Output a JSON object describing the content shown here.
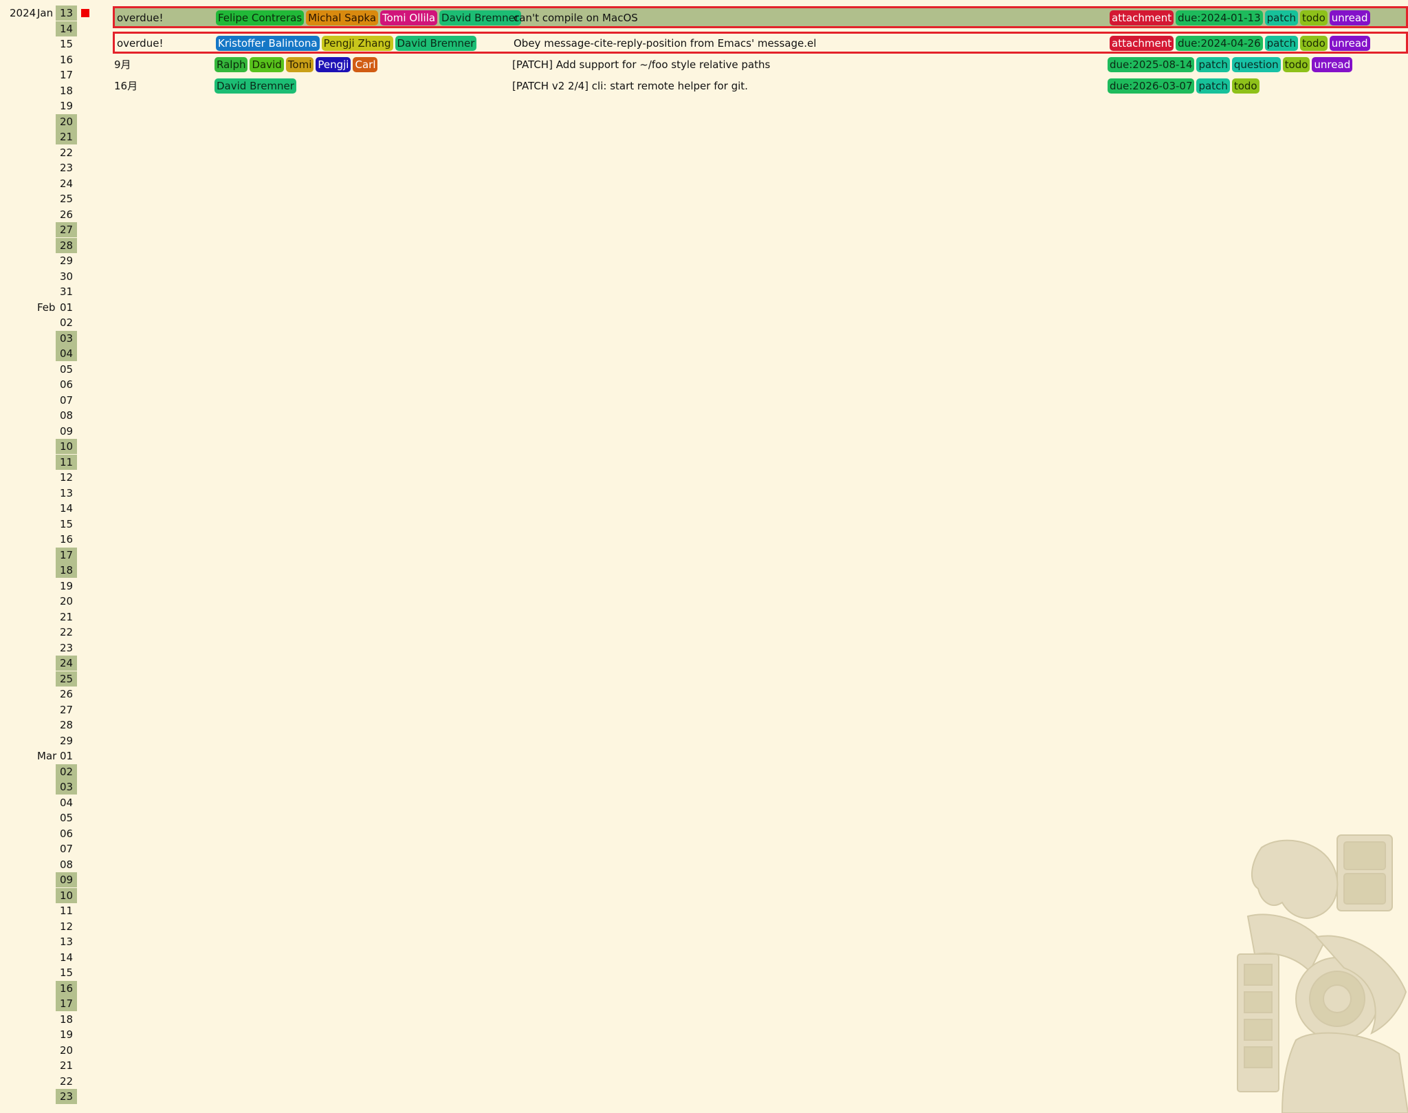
{
  "calendar": [
    {
      "year": "2024",
      "month": "Jan",
      "day": "13",
      "weekend": true,
      "today": true
    },
    {
      "day": "14",
      "weekend": true
    },
    {
      "day": "15"
    },
    {
      "day": "16"
    },
    {
      "day": "17"
    },
    {
      "day": "18"
    },
    {
      "day": "19"
    },
    {
      "day": "20",
      "weekend": true
    },
    {
      "day": "21",
      "weekend": true
    },
    {
      "day": "22"
    },
    {
      "day": "23"
    },
    {
      "day": "24"
    },
    {
      "day": "25"
    },
    {
      "day": "26"
    },
    {
      "day": "27",
      "weekend": true
    },
    {
      "day": "28",
      "weekend": true
    },
    {
      "day": "29"
    },
    {
      "day": "30"
    },
    {
      "day": "31"
    },
    {
      "month": "Feb",
      "day": "01"
    },
    {
      "day": "02"
    },
    {
      "day": "03",
      "weekend": true
    },
    {
      "day": "04",
      "weekend": true
    },
    {
      "day": "05"
    },
    {
      "day": "06"
    },
    {
      "day": "07"
    },
    {
      "day": "08"
    },
    {
      "day": "09"
    },
    {
      "day": "10",
      "weekend": true
    },
    {
      "day": "11",
      "weekend": true
    },
    {
      "day": "12"
    },
    {
      "day": "13"
    },
    {
      "day": "14"
    },
    {
      "day": "15"
    },
    {
      "day": "16"
    },
    {
      "day": "17",
      "weekend": true
    },
    {
      "day": "18",
      "weekend": true
    },
    {
      "day": "19"
    },
    {
      "day": "20"
    },
    {
      "day": "21"
    },
    {
      "day": "22"
    },
    {
      "day": "23"
    },
    {
      "day": "24",
      "weekend": true
    },
    {
      "day": "25",
      "weekend": true
    },
    {
      "day": "26"
    },
    {
      "day": "27"
    },
    {
      "day": "28"
    },
    {
      "day": "29"
    },
    {
      "month": "Mar",
      "day": "01"
    },
    {
      "day": "02",
      "weekend": true
    },
    {
      "day": "03",
      "weekend": true
    },
    {
      "day": "04"
    },
    {
      "day": "05"
    },
    {
      "day": "06"
    },
    {
      "day": "07"
    },
    {
      "day": "08"
    },
    {
      "day": "09",
      "weekend": true
    },
    {
      "day": "10",
      "weekend": true
    },
    {
      "day": "11"
    },
    {
      "day": "12"
    },
    {
      "day": "13"
    },
    {
      "day": "14"
    },
    {
      "day": "15"
    },
    {
      "day": "16",
      "weekend": true
    },
    {
      "day": "17",
      "weekend": true
    },
    {
      "day": "18"
    },
    {
      "day": "19"
    },
    {
      "day": "20"
    },
    {
      "day": "21"
    },
    {
      "day": "22"
    },
    {
      "day": "23",
      "weekend": true
    }
  ],
  "messages": [
    {
      "when": "overdue!",
      "overdue": true,
      "selected": true,
      "authors": [
        {
          "name": "Felipe Contreras",
          "bg": "#21b938",
          "fg": "#0a2a0a"
        },
        {
          "name": "Michal Sapka",
          "bg": "#d98a0f",
          "fg": "#2a1500"
        },
        {
          "name": "Tomi Ollila",
          "bg": "#d1147a",
          "fg": "#ffffff"
        },
        {
          "name": "David Bremner",
          "bg": "#1cbd74",
          "fg": "#0a2a18"
        }
      ],
      "subject": "can't compile on MacOS",
      "tags": [
        {
          "name": "attachment",
          "bg": "#d41833",
          "fg": "#ffffff"
        },
        {
          "name": "due:2024-01-13",
          "bg": "#1ebb5c",
          "fg": "#0a2a14"
        },
        {
          "name": "patch",
          "bg": "#17c19a",
          "fg": "#0a2a22"
        },
        {
          "name": "todo",
          "bg": "#8ec11a",
          "fg": "#1a2a00"
        },
        {
          "name": "unread",
          "bg": "#8411c9",
          "fg": "#ffffff"
        }
      ]
    },
    {
      "when": "overdue!",
      "overdue": true,
      "selected": false,
      "authors": [
        {
          "name": "Kristoffer Balintona",
          "bg": "#1577c6",
          "fg": "#ffffff"
        },
        {
          "name": "Pengji Zhang",
          "bg": "#c8c61b",
          "fg": "#2a2a00"
        },
        {
          "name": "David Bremner",
          "bg": "#1cbd74",
          "fg": "#0a2a18"
        }
      ],
      "subject": "Obey message-cite-reply-position from Emacs' message.el",
      "tags": [
        {
          "name": "attachment",
          "bg": "#d41833",
          "fg": "#ffffff"
        },
        {
          "name": "due:2024-04-26",
          "bg": "#1ebb5c",
          "fg": "#0a2a14"
        },
        {
          "name": "patch",
          "bg": "#17c19a",
          "fg": "#0a2a22"
        },
        {
          "name": "todo",
          "bg": "#8ec11a",
          "fg": "#1a2a00"
        },
        {
          "name": "unread",
          "bg": "#8411c9",
          "fg": "#ffffff"
        }
      ]
    },
    {
      "when": "9月",
      "overdue": false,
      "selected": false,
      "authors": [
        {
          "name": "Ralph",
          "bg": "#35b83c",
          "fg": "#0a2a0a"
        },
        {
          "name": "David",
          "bg": "#58c21c",
          "fg": "#142a00"
        },
        {
          "name": "Tomi",
          "bg": "#caa017",
          "fg": "#2a1f00"
        },
        {
          "name": "Pengji",
          "bg": "#1d11b6",
          "fg": "#ffffff"
        },
        {
          "name": "Carl",
          "bg": "#d15c13",
          "fg": "#ffffff"
        }
      ],
      "subject": "[PATCH] Add support for ~/foo style relative paths",
      "tags": [
        {
          "name": "due:2025-08-14",
          "bg": "#1ebb5c",
          "fg": "#0a2a14"
        },
        {
          "name": "patch",
          "bg": "#17c19a",
          "fg": "#0a2a22"
        },
        {
          "name": "question",
          "bg": "#17c1a6",
          "fg": "#0a2a22"
        },
        {
          "name": "todo",
          "bg": "#8ec11a",
          "fg": "#1a2a00"
        },
        {
          "name": "unread",
          "bg": "#8411c9",
          "fg": "#ffffff"
        }
      ]
    },
    {
      "when": "16月",
      "overdue": false,
      "selected": false,
      "authors": [
        {
          "name": "David Bremner",
          "bg": "#1cbd74",
          "fg": "#0a2a18"
        }
      ],
      "subject": "[PATCH v2 2/4] cli: start remote helper for git.",
      "tags": [
        {
          "name": "due:2026-03-07",
          "bg": "#1ebb5c",
          "fg": "#0a2a14"
        },
        {
          "name": "patch",
          "bg": "#17c19a",
          "fg": "#0a2a22"
        },
        {
          "name": "todo",
          "bg": "#8ec11a",
          "fg": "#1a2a00"
        }
      ]
    }
  ],
  "watermark": {
    "icon": "mesoamerican-deity-carving"
  }
}
